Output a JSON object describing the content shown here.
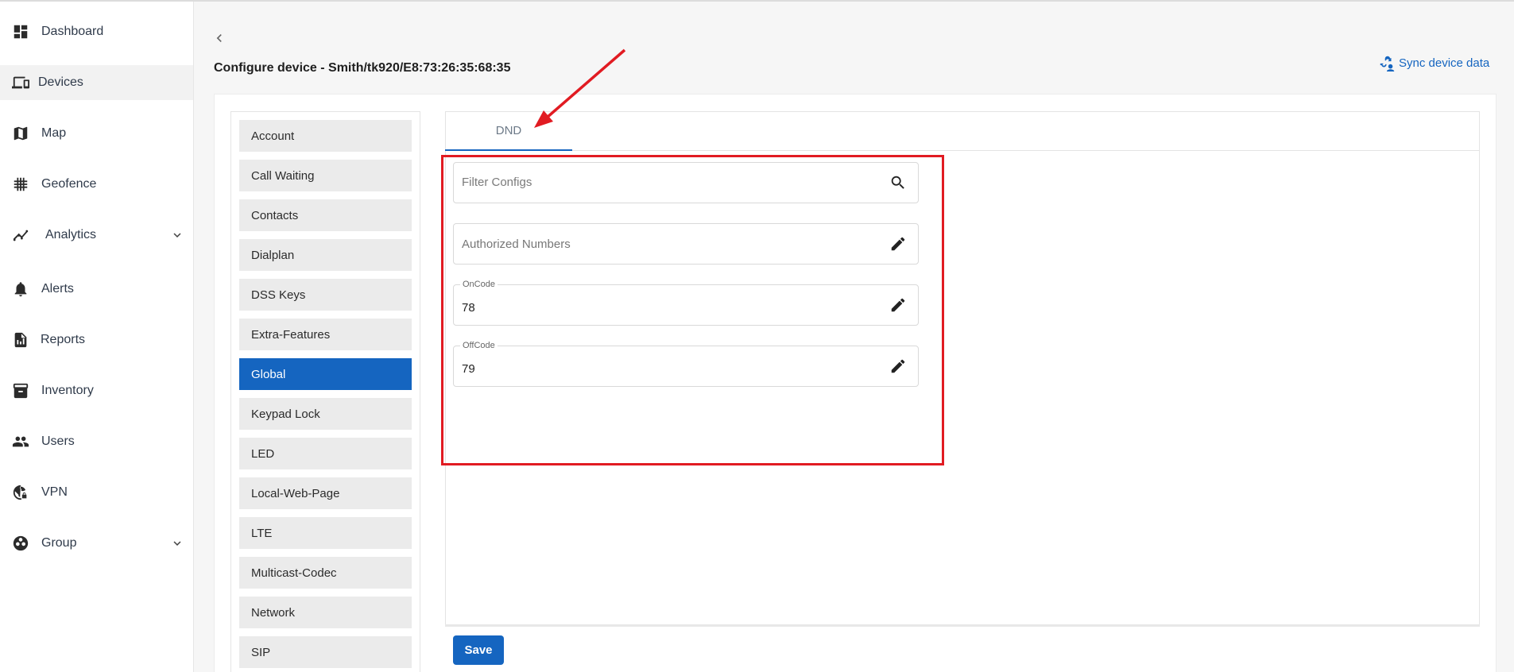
{
  "sidebar": {
    "items": [
      {
        "label": "Dashboard",
        "icon": "dashboard-icon"
      },
      {
        "label": "Devices",
        "icon": "devices-icon",
        "active": true
      },
      {
        "label": "Map",
        "icon": "map-icon"
      },
      {
        "label": "Geofence",
        "icon": "geofence-icon"
      },
      {
        "label": "Analytics",
        "icon": "analytics-icon",
        "expandable": true
      },
      {
        "label": "Alerts",
        "icon": "bell-icon"
      },
      {
        "label": "Reports",
        "icon": "reports-icon"
      },
      {
        "label": "Inventory",
        "icon": "inventory-icon"
      },
      {
        "label": "Users",
        "icon": "users-icon"
      },
      {
        "label": "VPN",
        "icon": "vpn-icon"
      },
      {
        "label": "Group",
        "icon": "group-icon",
        "expandable": true
      }
    ]
  },
  "header": {
    "title": "Configure device - Smith/tk920/E8:73:26:35:68:35",
    "sync_label": "Sync device data"
  },
  "categories": {
    "items": [
      "Account",
      "Call Waiting",
      "Contacts",
      "Dialplan",
      "DSS Keys",
      "Extra-Features",
      "Global",
      "Keypad Lock",
      "LED",
      "Local-Web-Page",
      "LTE",
      "Multicast-Codec",
      "Network",
      "SIP"
    ],
    "selected": "Global"
  },
  "config": {
    "tab_label": "DND",
    "filter_placeholder": "Filter Configs",
    "authorized_numbers_label": "Authorized Numbers",
    "oncode_label": "OnCode",
    "oncode_value": "78",
    "offcode_label": "OffCode",
    "offcode_value": "79"
  },
  "footer": {
    "save_label": "Save"
  },
  "colors": {
    "accent": "#1565c0",
    "annotation": "#e11b22"
  }
}
